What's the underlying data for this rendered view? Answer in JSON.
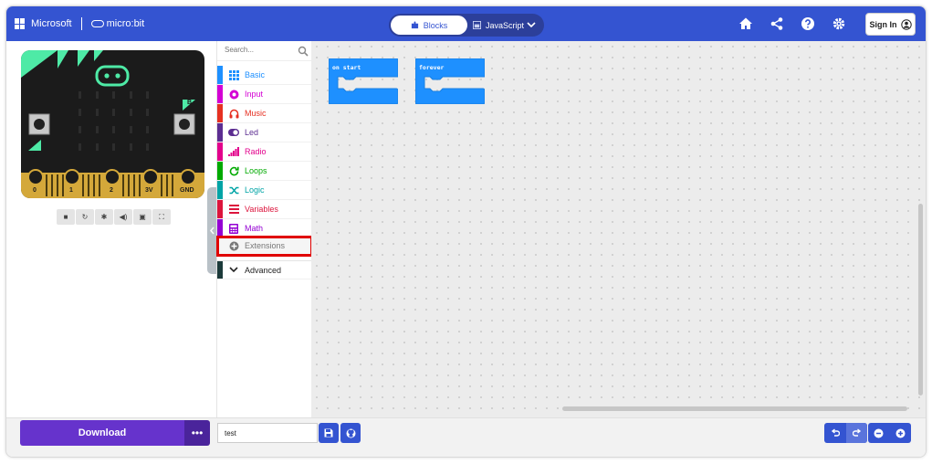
{
  "header": {
    "brand": "Microsoft",
    "product": "micro:bit",
    "tabs": [
      {
        "label": "Blocks",
        "active": true
      },
      {
        "label": "JavaScript",
        "active": false
      }
    ],
    "signin_label": "Sign In",
    "icons": [
      "home-icon",
      "share-icon",
      "help-icon",
      "gear-icon"
    ]
  },
  "simulator": {
    "pins": [
      "0",
      "1",
      "2",
      "3V",
      "GND"
    ],
    "button_a": "A",
    "button_b": "B",
    "controls": [
      "stop-icon",
      "restart-icon",
      "debug-icon",
      "mute-icon",
      "screenshot-icon",
      "fullscreen-icon"
    ]
  },
  "toolbox": {
    "search_placeholder": "Search...",
    "categories": [
      {
        "label": "Basic",
        "color": "#1e90ff"
      },
      {
        "label": "Input",
        "color": "#d400d4"
      },
      {
        "label": "Music",
        "color": "#e63022"
      },
      {
        "label": "Led",
        "color": "#5c2d91"
      },
      {
        "label": "Radio",
        "color": "#e3008c"
      },
      {
        "label": "Loops",
        "color": "#00aa00"
      },
      {
        "label": "Logic",
        "color": "#00a4a6"
      },
      {
        "label": "Variables",
        "color": "#dc143c"
      },
      {
        "label": "Math",
        "color": "#9400d3"
      }
    ],
    "extensions_label": "Extensions",
    "advanced_label": "Advanced"
  },
  "workspace": {
    "blocks": [
      {
        "label": "on start",
        "color": "#1e90ff"
      },
      {
        "label": "forever",
        "color": "#1e90ff"
      }
    ]
  },
  "footer": {
    "download_label": "Download",
    "project_name": "test"
  },
  "colors": {
    "header": "#3454d1",
    "download": "#6633cc",
    "board_accent": "#4eeaa6",
    "pin_gold": "#d4a83a"
  }
}
